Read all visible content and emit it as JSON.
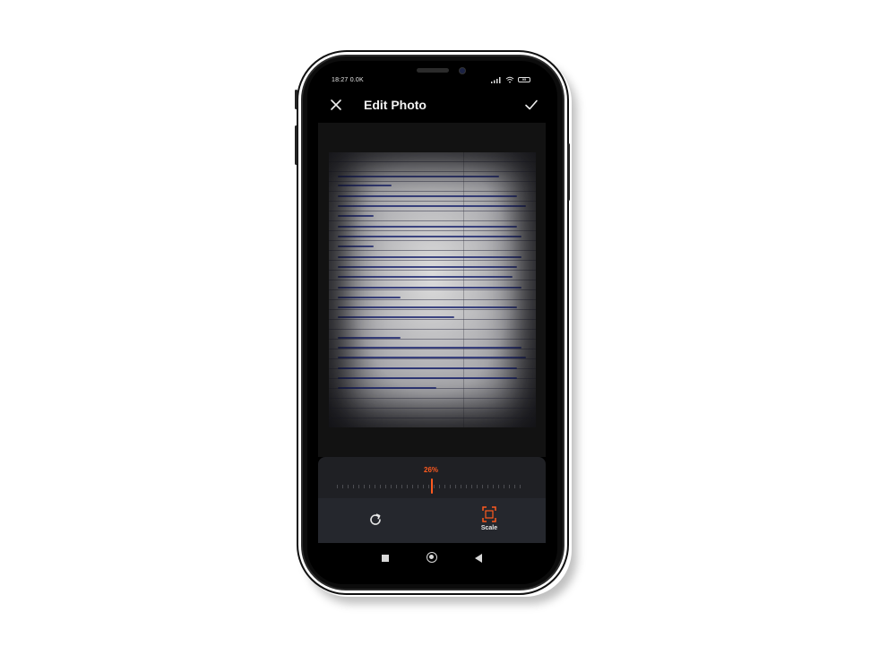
{
  "status_bar": {
    "time": "18:27",
    "network": "0.0K",
    "battery": "95"
  },
  "header": {
    "title": "Edit Photo",
    "close_icon": "close-icon",
    "confirm_icon": "check-icon"
  },
  "adjust": {
    "percent": "26%",
    "accent_color": "#ff5a1f",
    "level_fraction": 0.52
  },
  "tools": [
    {
      "id": "rotate",
      "icon": "rotate-icon",
      "label": ""
    },
    {
      "id": "scale",
      "icon": "scale-crop-icon",
      "label": "Scale"
    }
  ],
  "nav": {
    "recents_icon": "square-icon",
    "home_icon": "circle-icon",
    "back_icon": "triangle-back-icon"
  }
}
